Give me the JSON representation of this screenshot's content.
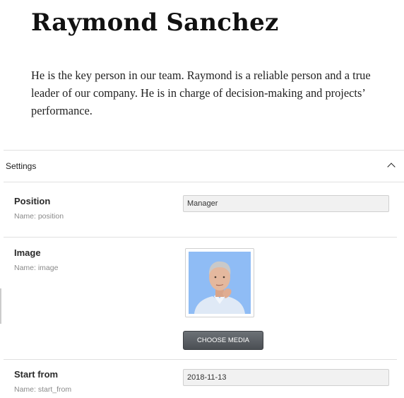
{
  "post": {
    "title": "Raymond Sanchez",
    "body": "He is the key person in our team. Raymond is a reliable person and a true leader of our company. He is in charge of decision-making and projects’ performance."
  },
  "settings": {
    "title": "Settings",
    "toggle_icon": "chevron-up-icon",
    "fields": {
      "position": {
        "label": "Position",
        "name_hint": "Name: position",
        "value": "Manager"
      },
      "image": {
        "label": "Image",
        "name_hint": "Name: image",
        "button_label": "CHOOSE MEDIA"
      },
      "start_from": {
        "label": "Start from",
        "name_hint": "Name: start_from",
        "value": "2018-11-13"
      }
    }
  },
  "colors": {
    "thumb_background": "#8fbcf5",
    "button_dark": "#53575c"
  }
}
